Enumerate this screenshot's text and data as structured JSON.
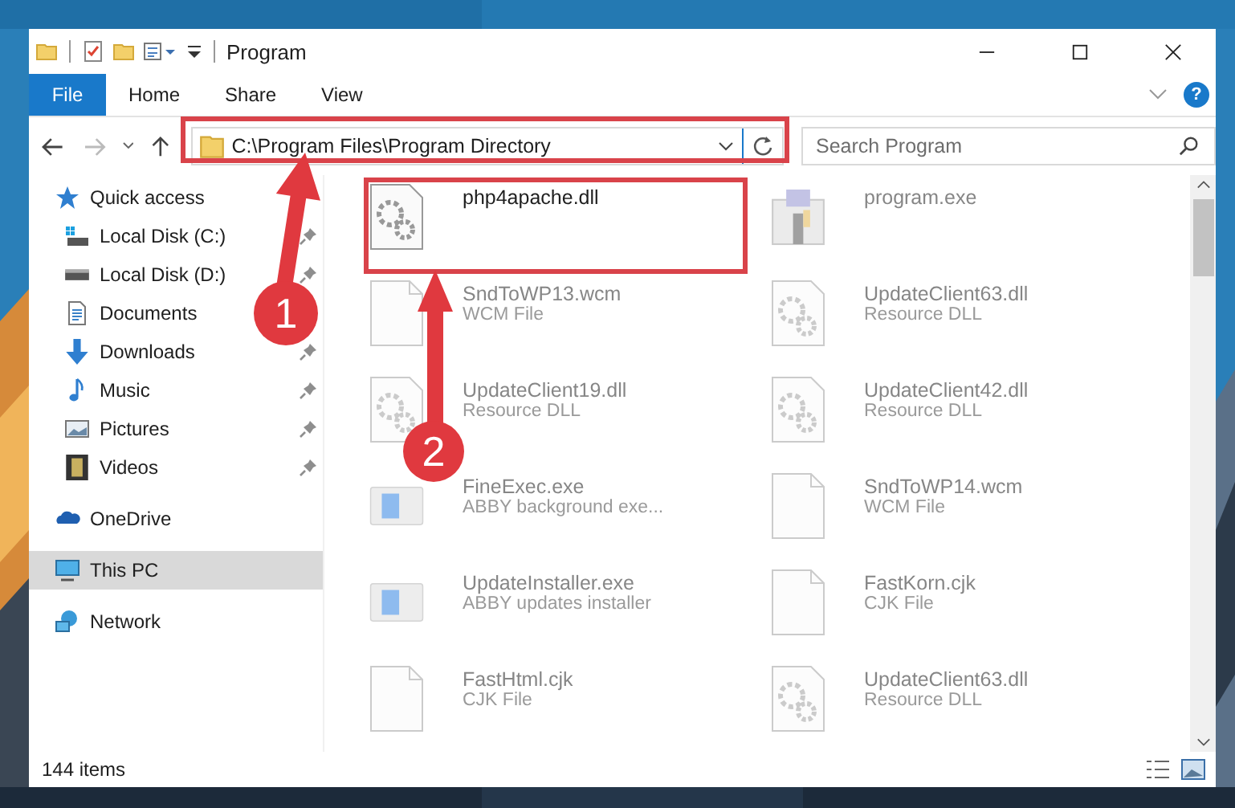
{
  "window": {
    "title": "Program"
  },
  "ribbon": {
    "file_tab": "File",
    "tabs": [
      {
        "label": "Home",
        "selected": false
      },
      {
        "label": "Share",
        "selected": false
      },
      {
        "label": "View",
        "selected": false
      }
    ],
    "help": "?"
  },
  "address": {
    "path": "C:\\Program Files\\Program Directory"
  },
  "search": {
    "placeholder": "Search Program"
  },
  "nav": [
    {
      "label": "Quick access",
      "kind": "star",
      "selected": false,
      "children": [
        {
          "label": "Local Disk (C:)",
          "kind": "drive-c",
          "pinned": true,
          "selected": false
        },
        {
          "label": "Local Disk (D:)",
          "kind": "drive",
          "pinned": true,
          "selected": false
        },
        {
          "label": "Documents",
          "kind": "docs",
          "selected": false
        },
        {
          "label": "Downloads",
          "kind": "download",
          "pinned": true,
          "selected": false
        },
        {
          "label": "Music",
          "kind": "music",
          "pinned": true,
          "selected": false
        },
        {
          "label": "Pictures",
          "kind": "pictures",
          "pinned": true,
          "selected": false
        },
        {
          "label": "Videos",
          "kind": "videos",
          "pinned": true,
          "selected": false
        }
      ]
    },
    {
      "label": "OneDrive",
      "kind": "cloud",
      "selected": false
    },
    {
      "label": "This PC",
      "kind": "pc",
      "selected": true
    },
    {
      "label": "Network",
      "kind": "network",
      "selected": false
    }
  ],
  "files": [
    {
      "name": "php4apache.dll",
      "kind": "dll",
      "faded": false
    },
    {
      "name": "program.exe",
      "kind": "exe",
      "faded": true
    },
    {
      "name": "SndToWP13.wcm",
      "type": "WCM File",
      "kind": "doc",
      "faded": true
    },
    {
      "name": "UpdateClient63.dll",
      "type": "Resource DLL",
      "kind": "dll",
      "faded": true
    },
    {
      "name": "UpdateClient19.dll",
      "type": "Resource DLL",
      "kind": "dll",
      "faded": true
    },
    {
      "name": "UpdateClient42.dll",
      "type": "Resource DLL",
      "kind": "dll",
      "faded": true
    },
    {
      "name": "FineExec.exe",
      "type": "ABBY background exe...",
      "kind": "app",
      "faded": true
    },
    {
      "name": "SndToWP14.wcm",
      "type": "WCM File",
      "kind": "doc",
      "faded": true
    },
    {
      "name": "UpdateInstaller.exe",
      "type": "ABBY updates installer",
      "kind": "app",
      "faded": true
    },
    {
      "name": "FastKorn.cjk",
      "type": "CJK File",
      "kind": "doc",
      "faded": true
    },
    {
      "name": "FastHtml.cjk",
      "type": "CJK File",
      "kind": "doc",
      "faded": true
    },
    {
      "name": "UpdateClient63.dll",
      "type": "Resource DLL",
      "kind": "dll",
      "faded": true
    }
  ],
  "status_bar": {
    "count": "144 items"
  },
  "annotations": [
    {
      "number": "1"
    },
    {
      "number": "2"
    }
  ]
}
